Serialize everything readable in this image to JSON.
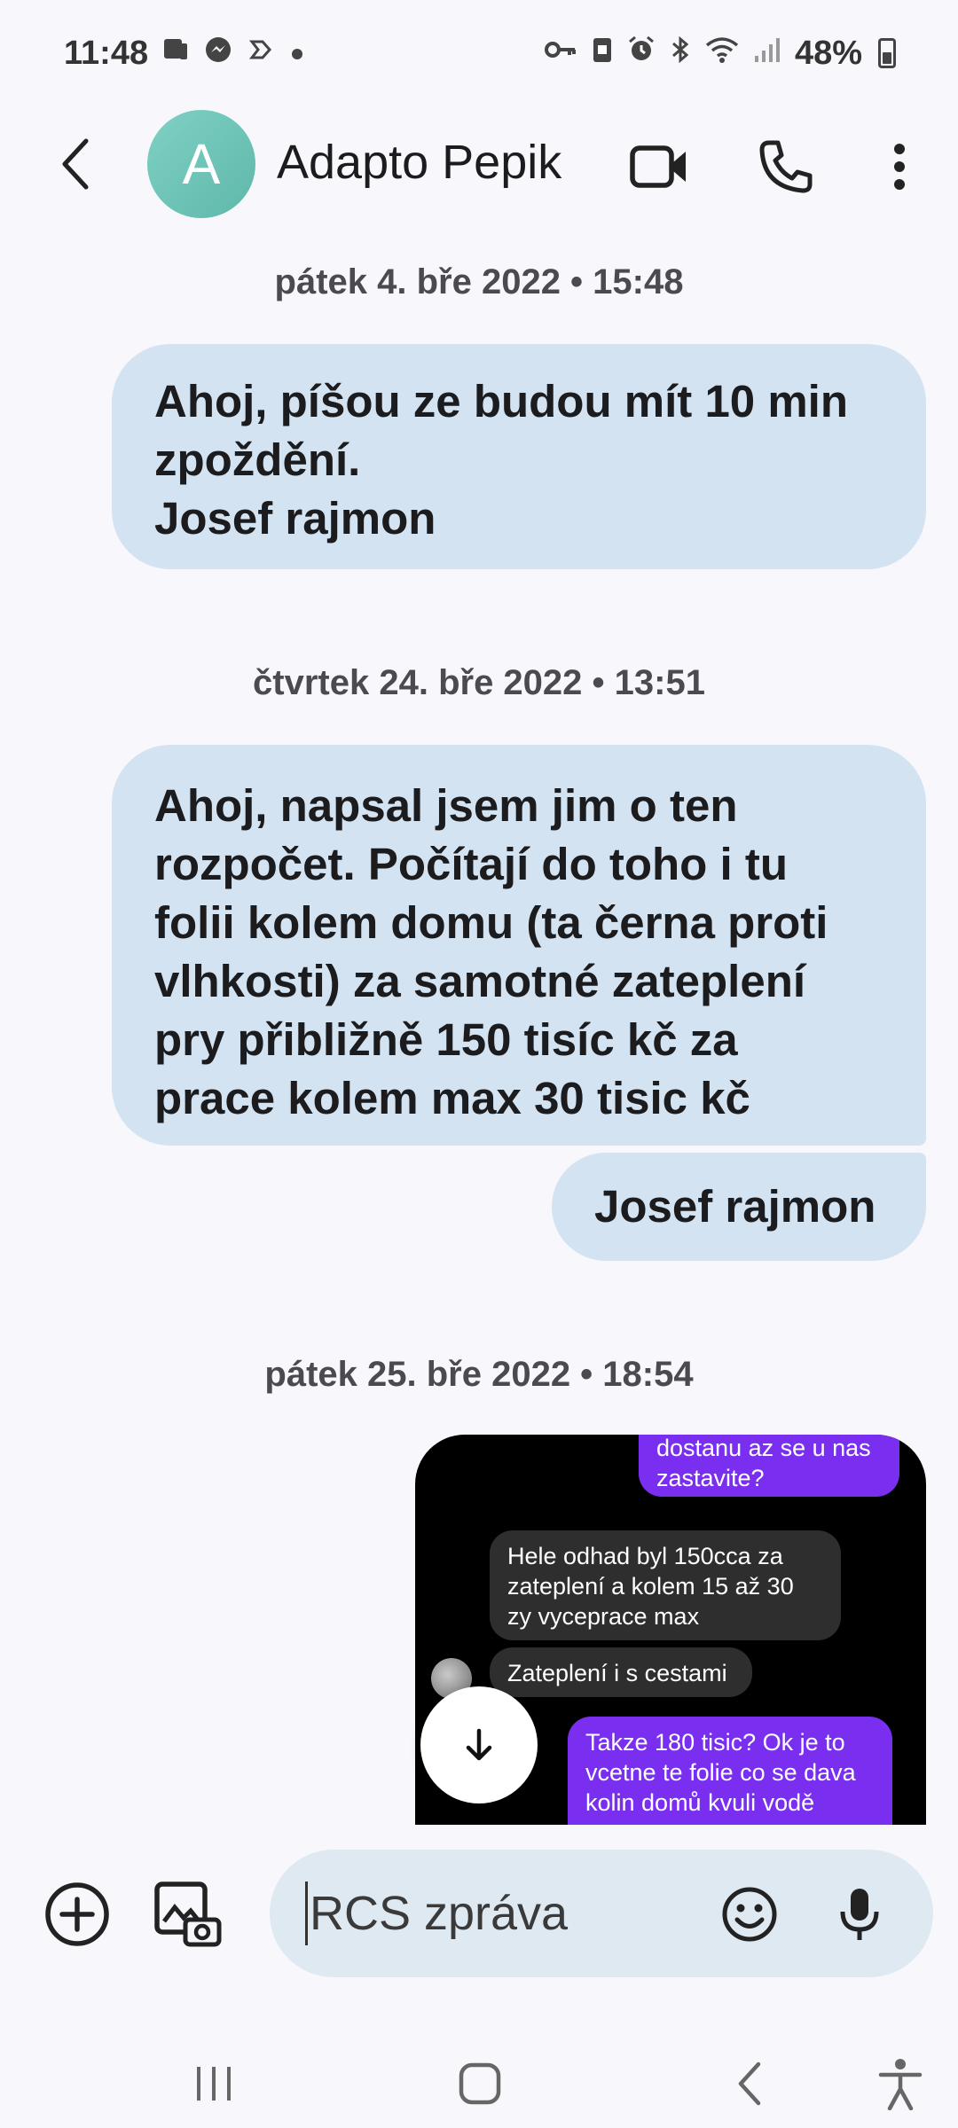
{
  "status_bar": {
    "time": "11:48",
    "battery": "48%",
    "icons_left": [
      "screen-mirror-icon",
      "messenger-icon",
      "sync-icon",
      "dot-icon"
    ],
    "icons_right": [
      "vpn-key-icon",
      "clipboard-icon",
      "alarm-icon",
      "bluetooth-icon",
      "wifi-icon",
      "signal-icon",
      "battery-icon"
    ]
  },
  "header": {
    "avatar_letter": "A",
    "contact_name": "Adapto Pepik",
    "avatar_color": "#6cc4b7"
  },
  "messages": [
    {
      "type": "date",
      "text": "pátek 4. bře 2022 • 15:48"
    },
    {
      "type": "outgoing",
      "text": "Ahoj, píšou ze budou mít 10 min\nzpoždění.\nJosef rajmon"
    },
    {
      "type": "date",
      "text": "čtvrtek 24. bře 2022 • 13:51"
    },
    {
      "type": "outgoing",
      "text": "Ahoj, napsal jsem jim o ten\nrozpočet. Počítají do toho i tu\nfolii kolem domu (ta černa proti\nvlhkosti) za samotné zateplení\npry přibližně 150 tisíc kč za\nprace kolem max 30 tisic kč"
    },
    {
      "type": "outgoing",
      "text": "Josef rajmon"
    },
    {
      "type": "date",
      "text": "pátek 25. bře 2022 • 18:54"
    }
  ],
  "image_message": {
    "bubbles": [
      {
        "side": "right",
        "text": "dostanu az se u nas\nzastavite?"
      },
      {
        "side": "left",
        "text": "Hele odhad byl 150cca za\nzateplení a kolem 15 až 30\nzy vyceprace max"
      },
      {
        "side": "left",
        "text": "Zateplení i s cestami"
      },
      {
        "side": "right",
        "text": "Takze 180 tisic? Ok je to\nvcetne te folie co se dava\nkolin domů kvuli vodě"
      }
    ]
  },
  "compose": {
    "placeholder": "RCS zpráva"
  },
  "colors": {
    "bubble_outgoing": "#d3e3f2",
    "background": "#f8f8fc",
    "compose_field": "#dfe9f1",
    "ig_purple": "#7a2ef0"
  }
}
